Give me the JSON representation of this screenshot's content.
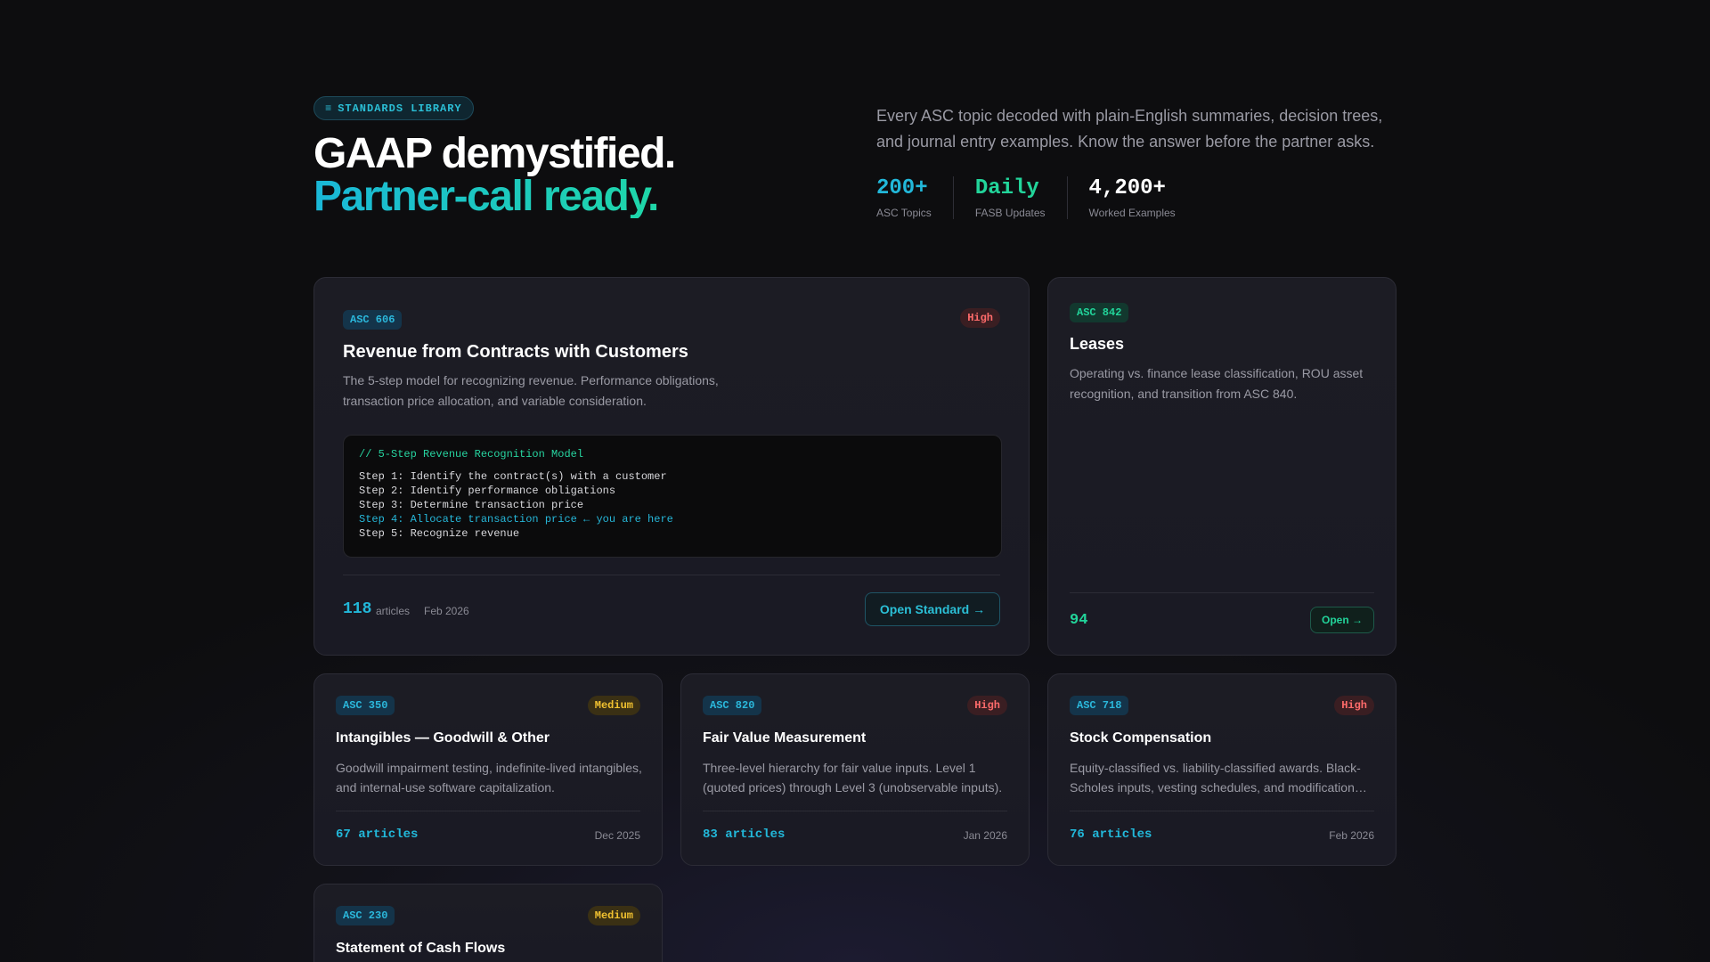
{
  "hero": {
    "pill_icon": "≡",
    "pill_label": "STANDARDS LIBRARY",
    "title_line1": "GAAP demystified.",
    "title_line2": "Partner-call ready.",
    "description": "Every ASC topic decoded with plain-English summaries, decision trees, and journal entry examples. Know the answer before the partner asks.",
    "stats": [
      {
        "value": "200+",
        "label": "ASC Topics",
        "color": "#22b8da"
      },
      {
        "value": "Daily",
        "label": "FASB Updates",
        "color": "#22d49a"
      },
      {
        "value": "4,200+",
        "label": "Worked Examples",
        "color": "#ffffff"
      }
    ]
  },
  "featured": {
    "tag": "ASC 606",
    "badge": "High",
    "title": "Revenue from Contracts with Customers",
    "description": "The 5-step model for recognizing revenue. Performance obligations, transaction price allocation, and variable consideration.",
    "code": {
      "comment": "// 5-Step Revenue Recognition Model",
      "lines": [
        "Step 1: Identify the contract(s) with a customer",
        "Step 2: Identify performance obligations",
        "Step 3: Determine transaction price",
        "Step 4: Allocate transaction price ← you are here",
        "Step 5: Recognize revenue"
      ]
    },
    "count": "118",
    "count_label": "articles",
    "date": "Feb 2026",
    "button": "Open Standard →"
  },
  "leases": {
    "tag": "ASC 842",
    "title": "Leases",
    "description": "Operating vs. finance lease classification, ROU asset recognition, and transition from ASC 840.",
    "count": "94",
    "button": "Open →"
  },
  "cards": [
    {
      "tag": "ASC 350",
      "badge": "Medium",
      "title": "Intangibles — Goodwill & Other",
      "description": "Goodwill impairment testing, indefinite-lived intangibles, and internal-use software capitalization.",
      "articles": "67 articles",
      "date": "Dec 2025"
    },
    {
      "tag": "ASC 820",
      "badge": "High",
      "title": "Fair Value Measurement",
      "description": "Three-level hierarchy for fair value inputs. Level 1 (quoted prices) through Level 3 (unobservable inputs).",
      "articles": "83 articles",
      "date": "Jan 2026"
    },
    {
      "tag": "ASC 718",
      "badge": "High",
      "title": "Stock Compensation",
      "description": "Equity-classified vs. liability-classified awards. Black-Scholes inputs, vesting schedules, and modification…",
      "articles": "76 articles",
      "date": "Feb 2026"
    },
    {
      "tag": "ASC 230",
      "badge": "Medium",
      "title": "Statement of Cash Flows"
    }
  ]
}
